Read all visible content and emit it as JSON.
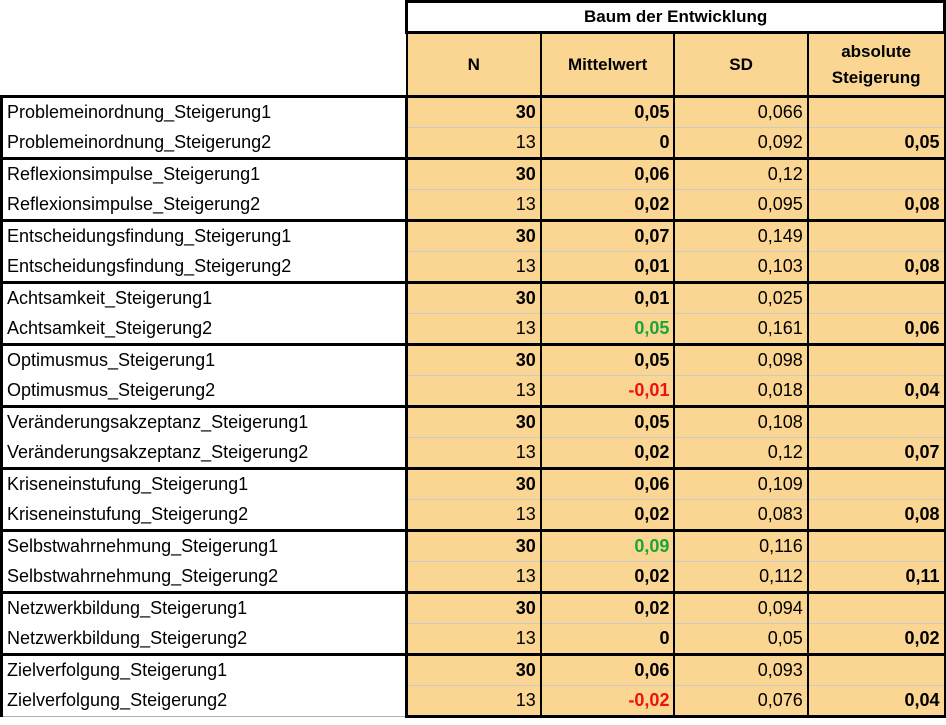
{
  "table": {
    "title": "Baum der Entwicklung",
    "headers": [
      "N",
      "Mittelwert",
      "SD",
      "absolute Steigerung"
    ],
    "rows": [
      {
        "label": "Problemeinordnung_Steigerung1",
        "n": "30",
        "mean": "0,05",
        "sd": "0,066",
        "abs": "",
        "mean_color": "default"
      },
      {
        "label": "Problemeinordnung_Steigerung2",
        "n": "13",
        "mean": "0",
        "sd": "0,092",
        "abs": "0,05",
        "mean_color": "default"
      },
      {
        "label": "Reflexionsimpulse_Steigerung1",
        "n": "30",
        "mean": "0,06",
        "sd": "0,12",
        "abs": "",
        "mean_color": "default"
      },
      {
        "label": "Reflexionsimpulse_Steigerung2",
        "n": "13",
        "mean": "0,02",
        "sd": "0,095",
        "abs": "0,08",
        "mean_color": "default"
      },
      {
        "label": "Entscheidungsfindung_Steigerung1",
        "n": "30",
        "mean": "0,07",
        "sd": "0,149",
        "abs": "",
        "mean_color": "default"
      },
      {
        "label": "Entscheidungsfindung_Steigerung2",
        "n": "13",
        "mean": "0,01",
        "sd": "0,103",
        "abs": "0,08",
        "mean_color": "default"
      },
      {
        "label": "Achtsamkeit_Steigerung1",
        "n": "30",
        "mean": "0,01",
        "sd": "0,025",
        "abs": "",
        "mean_color": "default"
      },
      {
        "label": "Achtsamkeit_Steigerung2",
        "n": "13",
        "mean": "0,05",
        "sd": "0,161",
        "abs": "0,06",
        "mean_color": "#1aa53a"
      },
      {
        "label": "Optimusmus_Steigerung1",
        "n": "30",
        "mean": "0,05",
        "sd": "0,098",
        "abs": "",
        "mean_color": "default"
      },
      {
        "label": "Optimusmus_Steigerung2",
        "n": "13",
        "mean": "-0,01",
        "sd": "0,018",
        "abs": "0,04",
        "mean_color": "#ee1111"
      },
      {
        "label": "Veränderungsakzeptanz_Steigerung1",
        "n": "30",
        "mean": "0,05",
        "sd": "0,108",
        "abs": "",
        "mean_color": "default"
      },
      {
        "label": "Veränderungsakzeptanz_Steigerung2",
        "n": "13",
        "mean": "0,02",
        "sd": "0,12",
        "abs": "0,07",
        "mean_color": "default"
      },
      {
        "label": "Kriseneinstufung_Steigerung1",
        "n": "30",
        "mean": "0,06",
        "sd": "0,109",
        "abs": "",
        "mean_color": "default"
      },
      {
        "label": "Kriseneinstufung_Steigerung2",
        "n": "13",
        "mean": "0,02",
        "sd": "0,083",
        "abs": "0,08",
        "mean_color": "default"
      },
      {
        "label": "Selbstwahrnehmung_Steigerung1",
        "n": "30",
        "mean": "0,09",
        "sd": "0,116",
        "abs": "",
        "mean_color": "#1aa53a"
      },
      {
        "label": "Selbstwahrnehmung_Steigerung2",
        "n": "13",
        "mean": "0,02",
        "sd": "0,112",
        "abs": "0,11",
        "mean_color": "default"
      },
      {
        "label": "Netzwerkbildung_Steigerung1",
        "n": "30",
        "mean": "0,02",
        "sd": "0,094",
        "abs": "",
        "mean_color": "default"
      },
      {
        "label": "Netzwerkbildung_Steigerung2",
        "n": "13",
        "mean": "0",
        "sd": "0,05",
        "abs": "0,02",
        "mean_color": "default"
      },
      {
        "label": "Zielverfolgung_Steigerung1",
        "n": "30",
        "mean": "0,06",
        "sd": "0,093",
        "abs": "",
        "mean_color": "default"
      },
      {
        "label": "Zielverfolgung_Steigerung2",
        "n": "13",
        "mean": "-0,02",
        "sd": "0,076",
        "abs": "0,04",
        "mean_color": "#ee1111"
      }
    ]
  },
  "colors": {
    "cell_fill": "#fad692",
    "positive_highlight": "#1aa53a",
    "negative_highlight": "#ee1111"
  }
}
